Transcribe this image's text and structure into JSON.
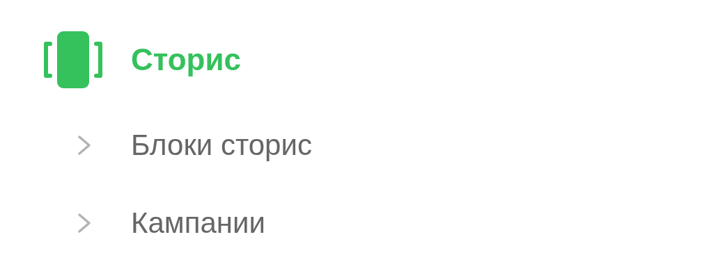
{
  "section": {
    "title": "Сторис",
    "selected": true,
    "children": [
      {
        "label": "Блоки сторис",
        "expanded": false
      },
      {
        "label": "Кампании",
        "expanded": false
      }
    ]
  }
}
